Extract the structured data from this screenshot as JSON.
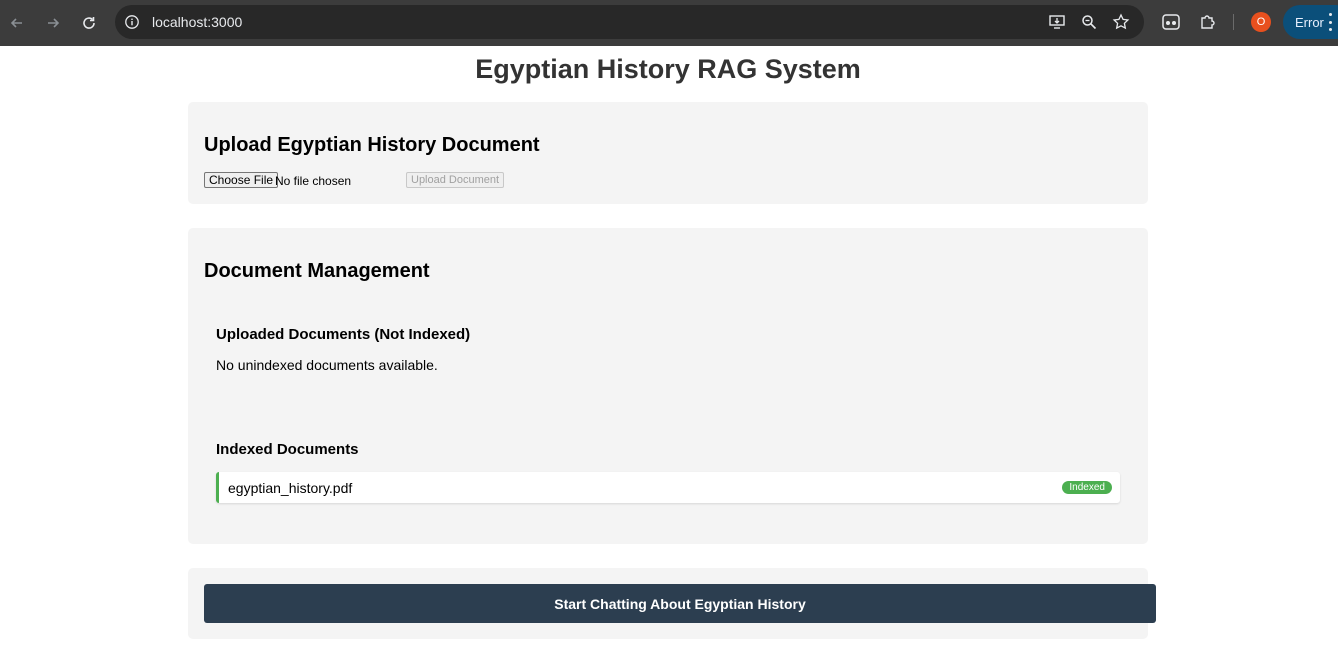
{
  "browser": {
    "url": "localhost:3000",
    "profile_initial": "O",
    "error_label": "Error",
    "icons": [
      "back-icon",
      "forward-icon",
      "reload-icon",
      "info-icon",
      "install-app-icon",
      "zoom-icon",
      "bookmark-star-icon",
      "extension-reader-icon",
      "extensions-puzzle-icon",
      "menu-kebab-icon"
    ]
  },
  "page": {
    "title": "Egyptian History RAG System"
  },
  "upload": {
    "heading": "Upload Egyptian History Document",
    "choose_file_label": "Choose File",
    "file_status": "No file chosen",
    "upload_button_label": "Upload Document"
  },
  "management": {
    "heading": "Document Management",
    "unindexed_heading": "Uploaded Documents (Not Indexed)",
    "unindexed_empty_message": "No unindexed documents available.",
    "indexed_heading": "Indexed Documents",
    "indexed_documents": [
      {
        "name": "egyptian_history.pdf",
        "status": "Indexed"
      }
    ]
  },
  "chat": {
    "button_label": "Start Chatting About Egyptian History"
  },
  "colors": {
    "browser_bar": "#3c3c3c",
    "card_background": "#f4f4f4",
    "indexed_accent": "#4caf50",
    "chat_button": "#2c3e50",
    "title_text": "#333333"
  }
}
